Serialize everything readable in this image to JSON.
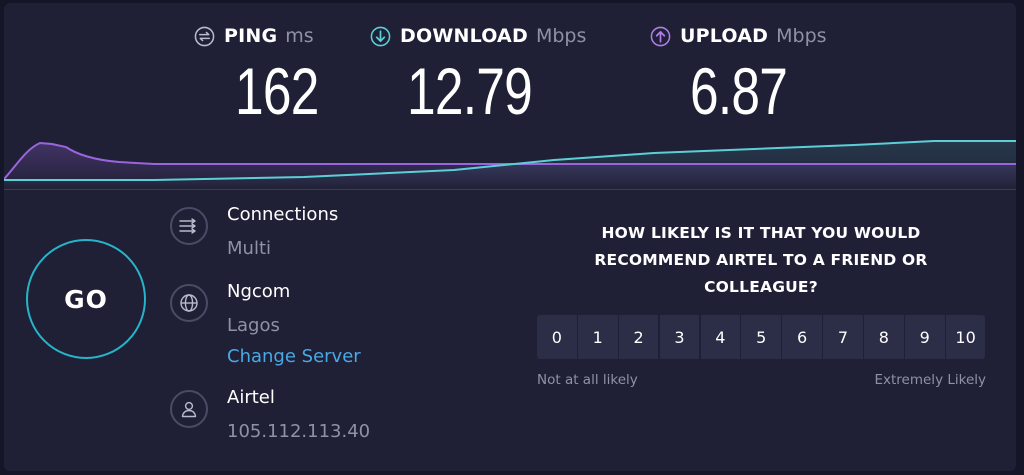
{
  "metrics": {
    "ping": {
      "label": "PING",
      "unit": "ms",
      "value": "162"
    },
    "download": {
      "label": "DOWNLOAD",
      "unit": "Mbps",
      "value": "12.79"
    },
    "upload": {
      "label": "UPLOAD",
      "unit": "Mbps",
      "value": "6.87"
    }
  },
  "go": {
    "label": "GO"
  },
  "connections": {
    "title": "Connections",
    "value": "Multi"
  },
  "server": {
    "title": "Ngcom",
    "location": "Lagos",
    "change_label": "Change Server"
  },
  "provider": {
    "title": "Airtel",
    "ip": "105.112.113.40"
  },
  "survey": {
    "question": "HOW LIKELY IS IT THAT YOU WOULD RECOMMEND AIRTEL TO A FRIEND OR COLLEAGUE?",
    "scale": [
      "0",
      "1",
      "2",
      "3",
      "4",
      "5",
      "6",
      "7",
      "8",
      "9",
      "10"
    ],
    "low_label": "Not at all likely",
    "high_label": "Extremely Likely"
  },
  "colors": {
    "background": "#1f2035",
    "download_accent": "#5ccfd6",
    "upload_accent": "#9a64de",
    "go_ring": "#27b4c8",
    "link": "#4aa8e6"
  }
}
